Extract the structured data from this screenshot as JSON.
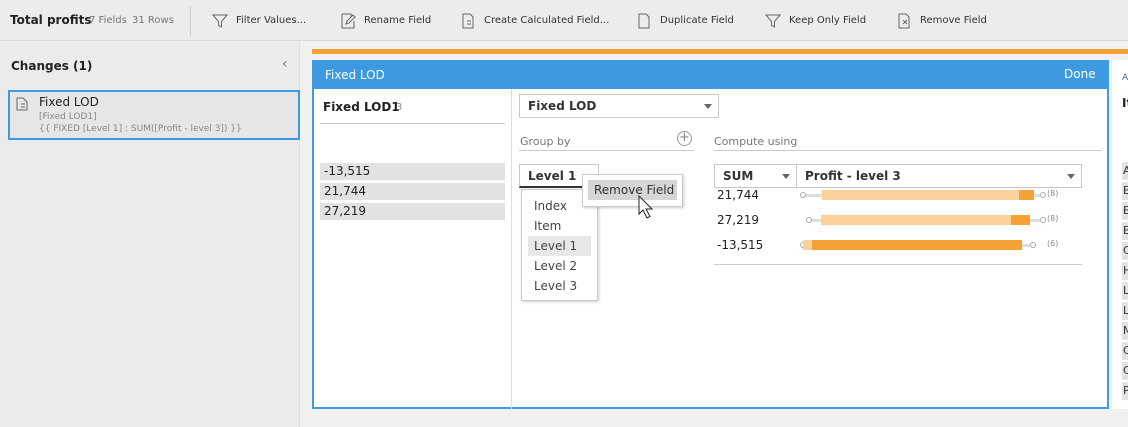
{
  "toolbar": {
    "title": "Total profits",
    "fields": "7 Fields",
    "rows": "31 Rows",
    "actions": [
      {
        "label": "Filter Values...",
        "icon": "filter-icon"
      },
      {
        "label": "Rename Field",
        "icon": "rename-icon"
      },
      {
        "label": "Create Calculated Field...",
        "icon": "calculated-field-icon"
      },
      {
        "label": "Duplicate Field",
        "icon": "duplicate-icon"
      },
      {
        "label": "Keep Only Field",
        "icon": "keep-only-icon"
      },
      {
        "label": "Remove Field",
        "icon": "remove-field-icon"
      }
    ]
  },
  "changes": {
    "title": "Changes (1)",
    "item": {
      "name": "Fixed LOD",
      "field": "[Fixed LOD1]",
      "formula": "{{ FIXED [Level 1] : SUM([Profit - level 3]) }}"
    }
  },
  "editor": {
    "title": "Fixed LOD",
    "done": "Done",
    "field_name": "Fixed LOD1",
    "field_count": "3",
    "values": [
      "-13,515",
      "21,744",
      "27,219"
    ],
    "calc_type": "Fixed LOD",
    "group_by_label": "Group by",
    "compute_label": "Compute using",
    "group_field": "Level 1",
    "group_options": [
      "Index",
      "Item",
      "Level 1",
      "Level 2",
      "Level 3"
    ],
    "context_menu": "Remove Field",
    "agg": "SUM",
    "measure": "Profit - level 3",
    "results": [
      {
        "value": "21,744",
        "count": "(8)",
        "box": [
          0,
          0.083,
          0.905,
          0.965,
          0.99
        ]
      },
      {
        "value": "27,219",
        "count": "(8)"
      },
      {
        "value": "-13,515",
        "count": "(6)",
        "box": [
          0,
          0.005,
          0.04,
          0.915,
          0.95
        ]
      }
    ]
  },
  "right_panel": {
    "header": "A",
    "title": "It",
    "letters": [
      "A",
      "E",
      "E",
      "E",
      "C",
      "H",
      "L",
      "L",
      "M",
      "C",
      "C",
      "P"
    ]
  },
  "colors": {
    "accent": "#3d9ae0",
    "orange": "#f5a133",
    "light_orange": "#fbd19b"
  }
}
